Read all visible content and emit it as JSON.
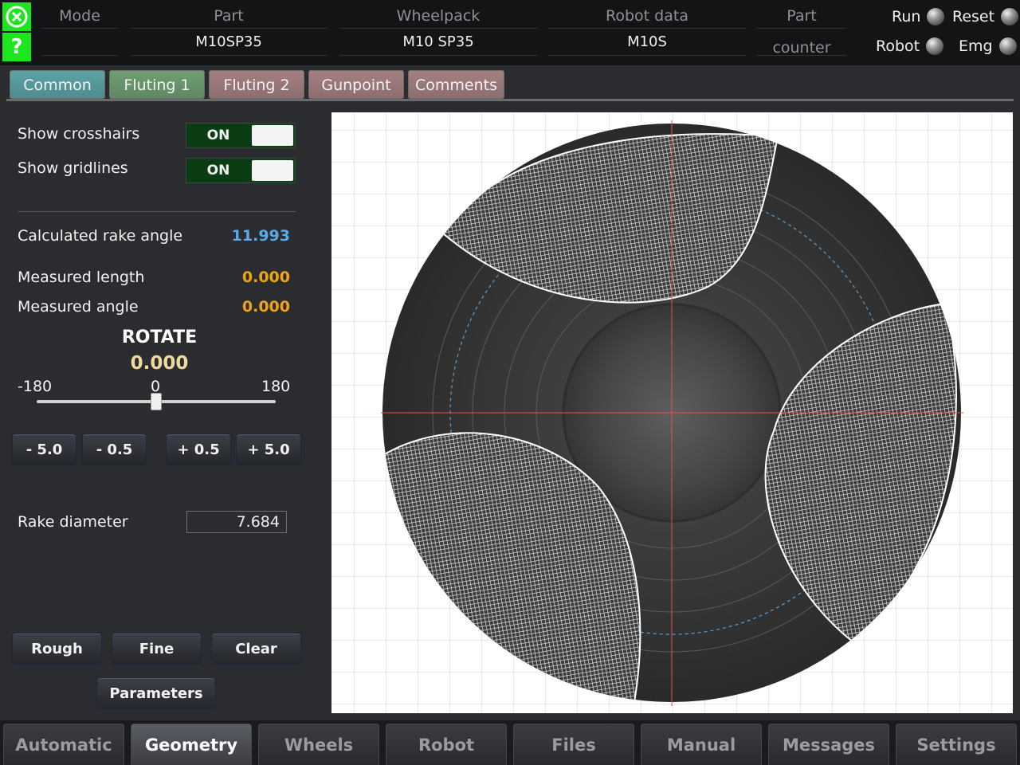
{
  "header": {
    "close_icon": "close-circle-icon",
    "help_label": "?",
    "columns": [
      {
        "label": "Mode",
        "value": ""
      },
      {
        "label": "Part",
        "value": "M10SP35"
      },
      {
        "label": "Wheelpack",
        "value": "M10 SP35"
      },
      {
        "label": "Robot data",
        "value": "M10S"
      },
      {
        "label": "Part counter",
        "value": ""
      }
    ],
    "indicators": {
      "run": "Run",
      "reset": "Reset",
      "robot": "Robot",
      "emg": "Emg"
    }
  },
  "subtabs": [
    {
      "label": "Common",
      "color": "#5aa3a5"
    },
    {
      "label": "Fluting 1",
      "color": "#6f9e72"
    },
    {
      "label": "Fluting 2",
      "color": "#a57f80"
    },
    {
      "label": "Gunpoint",
      "color": "#a57f80"
    },
    {
      "label": "Comments",
      "color": "#a57f80"
    }
  ],
  "panel": {
    "show_crosshairs": "Show crosshairs",
    "show_gridlines": "Show gridlines",
    "toggle_on": "ON",
    "calc_rake_label": "Calculated rake angle",
    "calc_rake_value": "11.993",
    "meas_length_label": "Measured length",
    "meas_length_value": "0.000",
    "meas_angle_label": "Measured angle",
    "meas_angle_value": "0.000",
    "rotate_title": "ROTATE",
    "rotate_value": "0.000",
    "slider_min": "-180",
    "slider_mid": "0",
    "slider_max": "180",
    "slider_value_fraction": 0.5,
    "step_buttons": [
      "- 5.0",
      "- 0.5",
      "+ 0.5",
      "+ 5.0"
    ],
    "rake_diameter_label": "Rake diameter",
    "rake_diameter_value": "7.684",
    "rough": "Rough",
    "fine": "Fine",
    "clear": "Clear",
    "parameters": "Parameters"
  },
  "colors": {
    "value_blue": "#5aaae8",
    "value_orange": "#f0a418",
    "crosshair": "#e05050"
  },
  "bottom_nav": [
    {
      "label": "Automatic",
      "active": false
    },
    {
      "label": "Geometry",
      "active": true
    },
    {
      "label": "Wheels",
      "active": false
    },
    {
      "label": "Robot",
      "active": false
    },
    {
      "label": "Files",
      "active": false
    },
    {
      "label": "Manual",
      "active": false
    },
    {
      "label": "Messages",
      "active": false
    },
    {
      "label": "Settings",
      "active": false
    }
  ]
}
